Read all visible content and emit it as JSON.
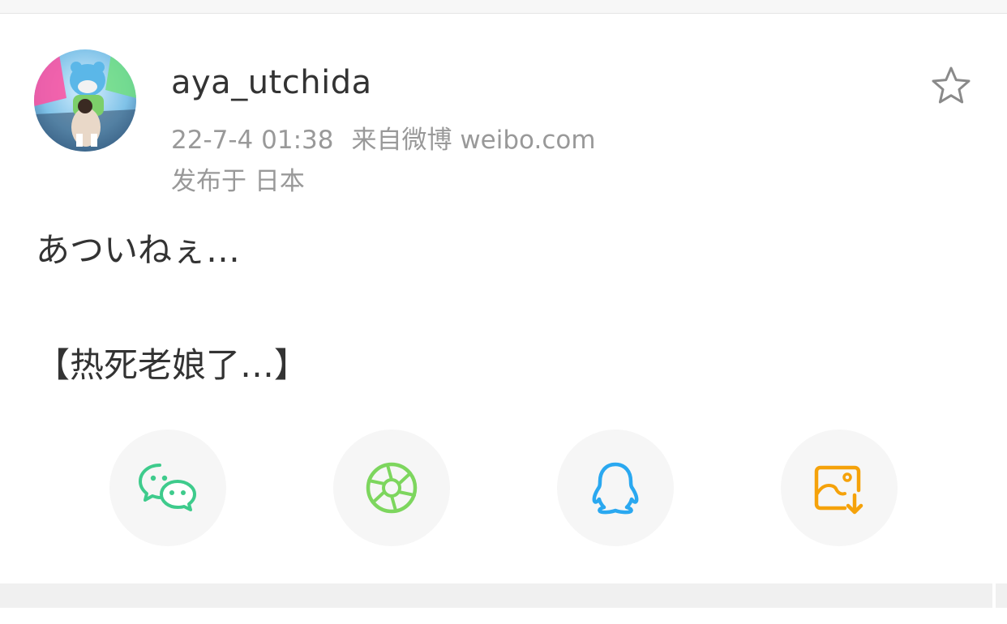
{
  "post": {
    "username": "aya_utchida",
    "timestamp": "22-7-4 01:38",
    "source": "来自微博 weibo.com",
    "location": "发布于 日本",
    "text_line1": "あついねぇ…",
    "text_line2": "【热死老娘了…】"
  },
  "icons": {
    "favorite": "star-outline-icon",
    "share": [
      "wechat-icon",
      "moments-icon",
      "qq-icon",
      "save-image-icon"
    ]
  },
  "colors": {
    "wechat": "#3ecb8c",
    "moments": "#7dd65e",
    "qq": "#2aa8f0",
    "save_image": "#f5a20a"
  }
}
